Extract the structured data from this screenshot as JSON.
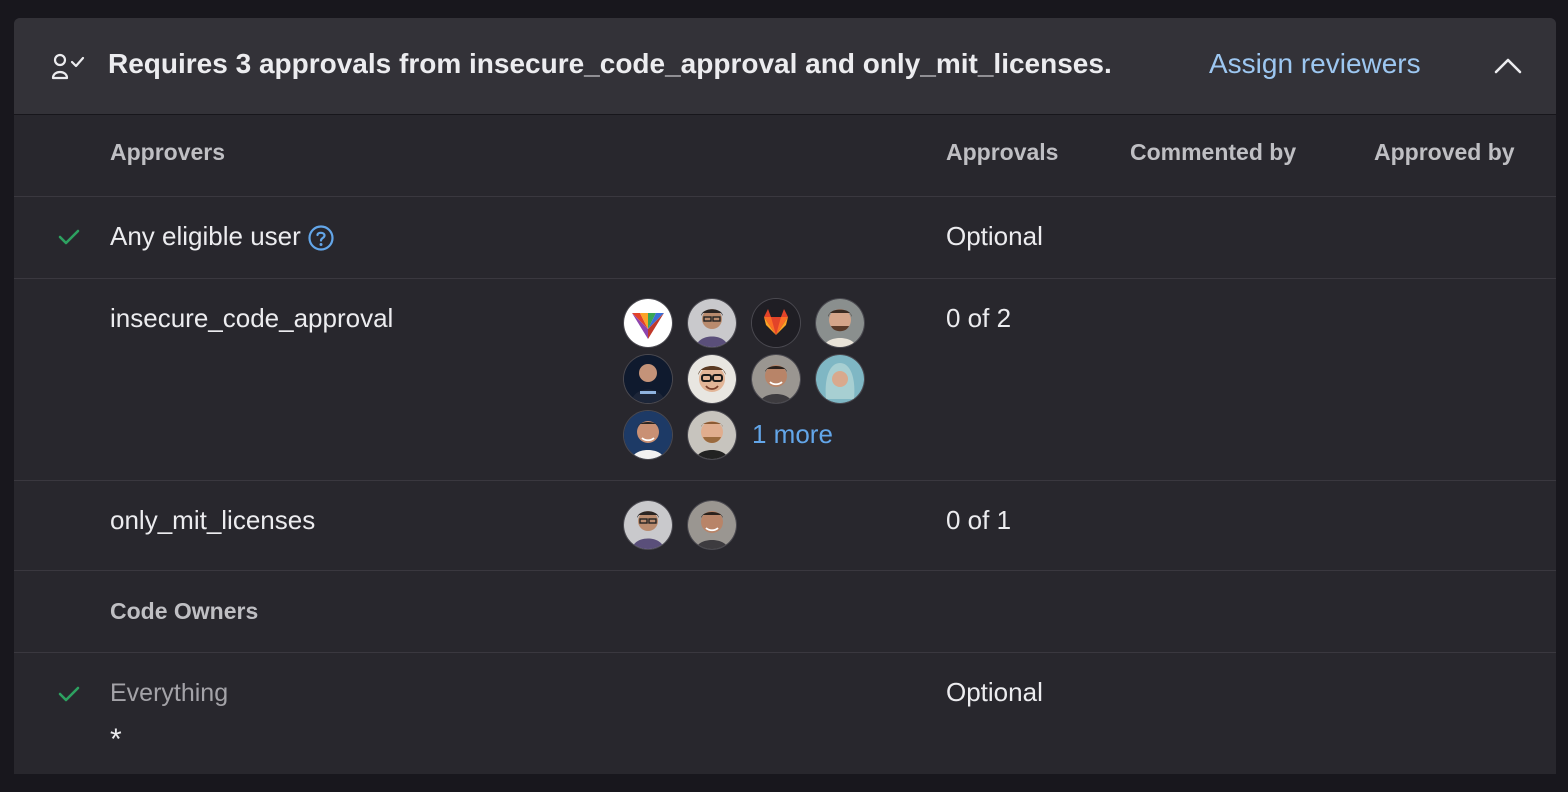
{
  "header": {
    "title": "Requires 3 approvals from insecure_code_approval and only_mit_licenses.",
    "assign_label": "Assign reviewers",
    "icon": "user-check-icon",
    "collapse_icon": "chevron-up-icon"
  },
  "table": {
    "columns": {
      "approvers": "Approvers",
      "approvals": "Approvals",
      "commented_by": "Commented by",
      "approved_by": "Approved by"
    },
    "rules": [
      {
        "name": "Any eligible user",
        "approvals": "Optional",
        "approved": true,
        "has_help": true
      },
      {
        "name": "insecure_code_approval",
        "approvals": "0 of 2",
        "approved": false,
        "more_label": "1 more"
      },
      {
        "name": "only_mit_licenses",
        "approvals": "0 of 1",
        "approved": false
      }
    ],
    "code_owners": {
      "heading": "Code Owners",
      "rule_name": "Everything",
      "pattern": "*",
      "approvals": "Optional",
      "approved": true
    }
  },
  "colors": {
    "accent_link": "#9dc7f1",
    "more_link": "#63a6e9",
    "success": "#2da160",
    "panel_bg": "#28272d",
    "header_bg": "#333238"
  }
}
